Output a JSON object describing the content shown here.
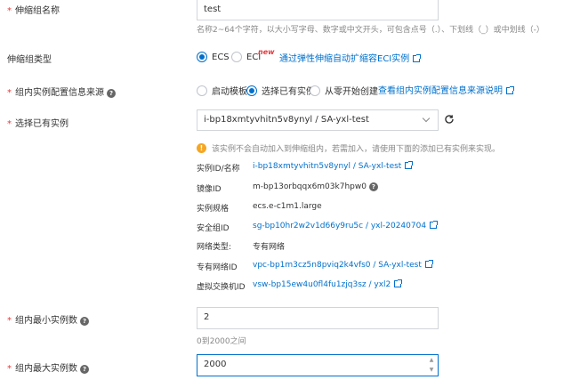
{
  "group_name": {
    "label": "伸缩组名称",
    "value": "test",
    "hint": "名称2~64个字符，以大小写字母、数字或中文开头，可包含点号（.）、下划线（_）或中划线（-）"
  },
  "group_type": {
    "label": "伸缩组类型",
    "options": [
      "ECS",
      "ECI"
    ],
    "selected": "ECS",
    "badge": "new",
    "link": "通过弹性伸缩自动扩缩容ECI实例"
  },
  "config_source": {
    "label": "组内实例配置信息来源",
    "options": [
      "启动模板",
      "选择已有实例",
      "从零开始创建"
    ],
    "selected": "选择已有实例",
    "link": "查看组内实例配置信息来源说明"
  },
  "existing_instance": {
    "label": "选择已有实例",
    "value": "i-bp18xmtyvhitn5v8ynyl / SA-yxl-test",
    "warning": "该实例不会自动加入到伸缩组内，若需加入，请使用下面的添加已有实例来实现。",
    "details": [
      {
        "key": "实例ID/名称",
        "value": "i-bp18xmtyvhitn5v8ynyl / SA-yxl-test",
        "type": "link"
      },
      {
        "key": "镜像ID",
        "value": "m-bp13orbqqx6m03k7hpw0",
        "type": "help"
      },
      {
        "key": "实例规格",
        "value": "ecs.e-c1m1.large",
        "type": "text"
      },
      {
        "key": "安全组ID",
        "value": "sg-bp10hr2w2v1d66y9ru5c / yxl-20240704",
        "type": "link"
      },
      {
        "key": "网络类型:",
        "value": "专有网络",
        "type": "text"
      },
      {
        "key": "专有网络ID",
        "value": "vpc-bp1m3cz5n8pviq2k4vfs0 / SA-yxl-test",
        "type": "link"
      },
      {
        "key": "虚拟交换机ID",
        "value": "vsw-bp15ew4u0fl4fu1zjq3sz / yxl2",
        "type": "link"
      }
    ]
  },
  "min_instances": {
    "label": "组内最小实例数",
    "value": "2",
    "hint": "0到2000之间"
  },
  "max_instances": {
    "label": "组内最大实例数",
    "value": "2000"
  },
  "colors": {
    "accent": "#0070cc",
    "required": "#e4393c",
    "warning": "#f5a623"
  }
}
